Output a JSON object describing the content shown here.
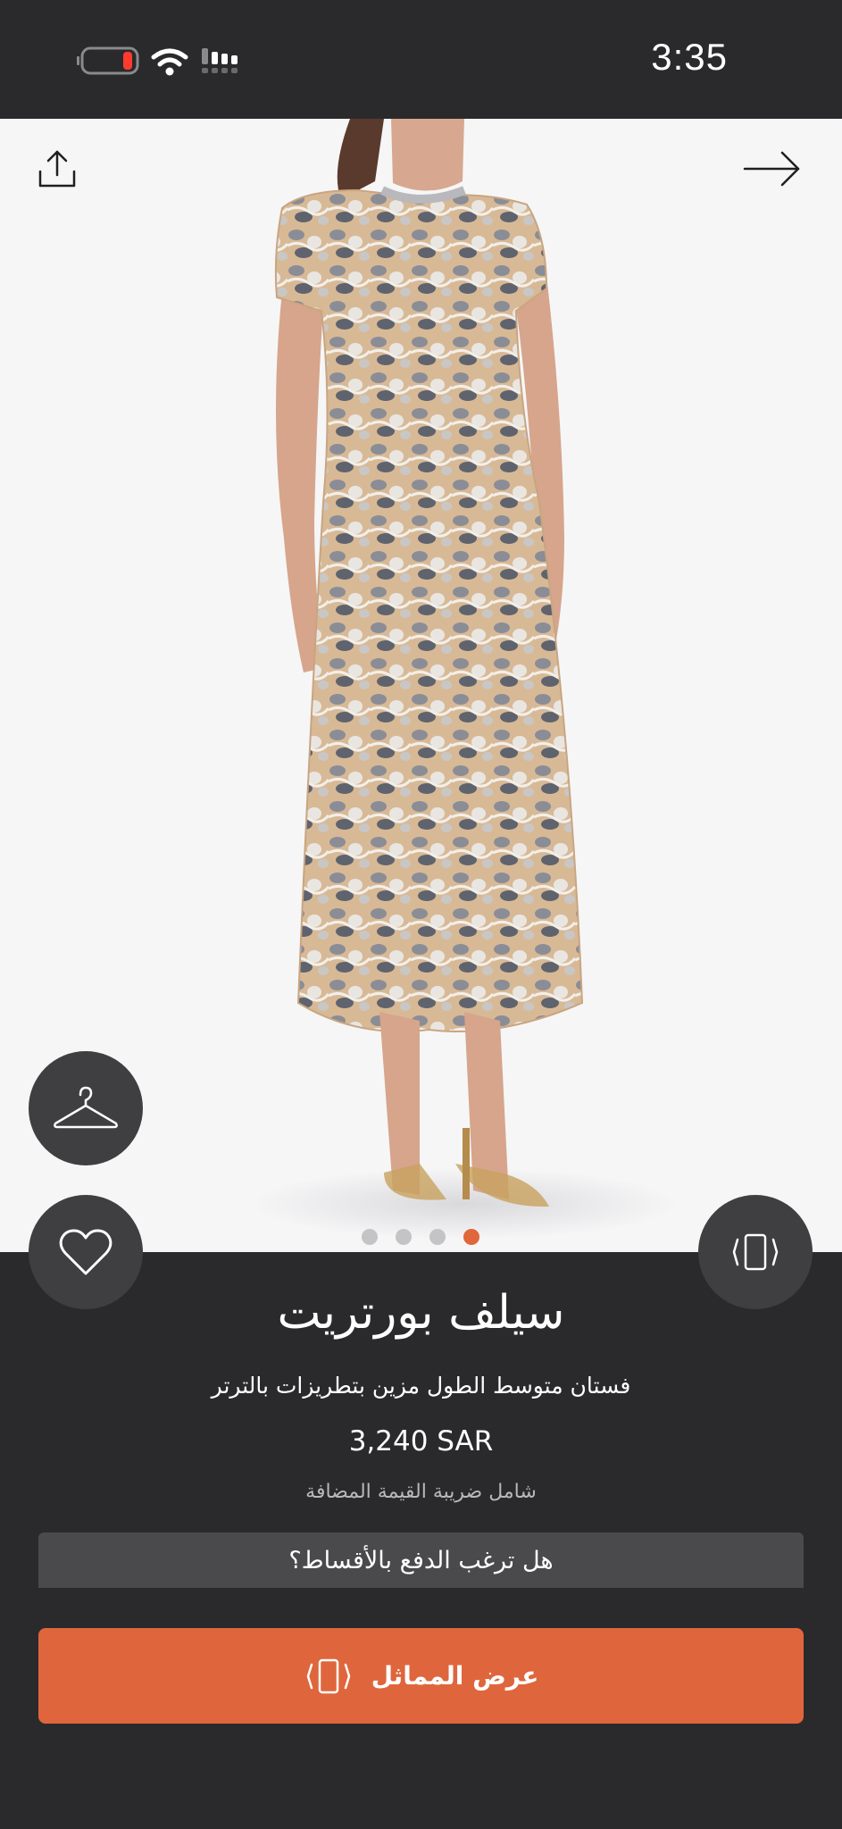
{
  "status_bar": {
    "time": "3:35"
  },
  "gallery": {
    "current_index": 4,
    "total": 4
  },
  "product": {
    "brand": "سيلف بورتريت",
    "description": "فستان متوسط الطول مزين بتطريزات بالترتر",
    "price": "3,240 SAR",
    "vat_note": "شامل ضريبة القيمة المضافة"
  },
  "installments": {
    "label": "هل ترغب الدفع بالأقساط؟"
  },
  "cta": {
    "label": "عرض المماثل"
  },
  "colors": {
    "accent": "#df663c",
    "dark": "#2a2a2c",
    "button_bg": "#3f3f41"
  },
  "icons": [
    "share-icon",
    "back-arrow-icon",
    "hanger-icon",
    "heart-icon",
    "rotate-phone-icon"
  ]
}
